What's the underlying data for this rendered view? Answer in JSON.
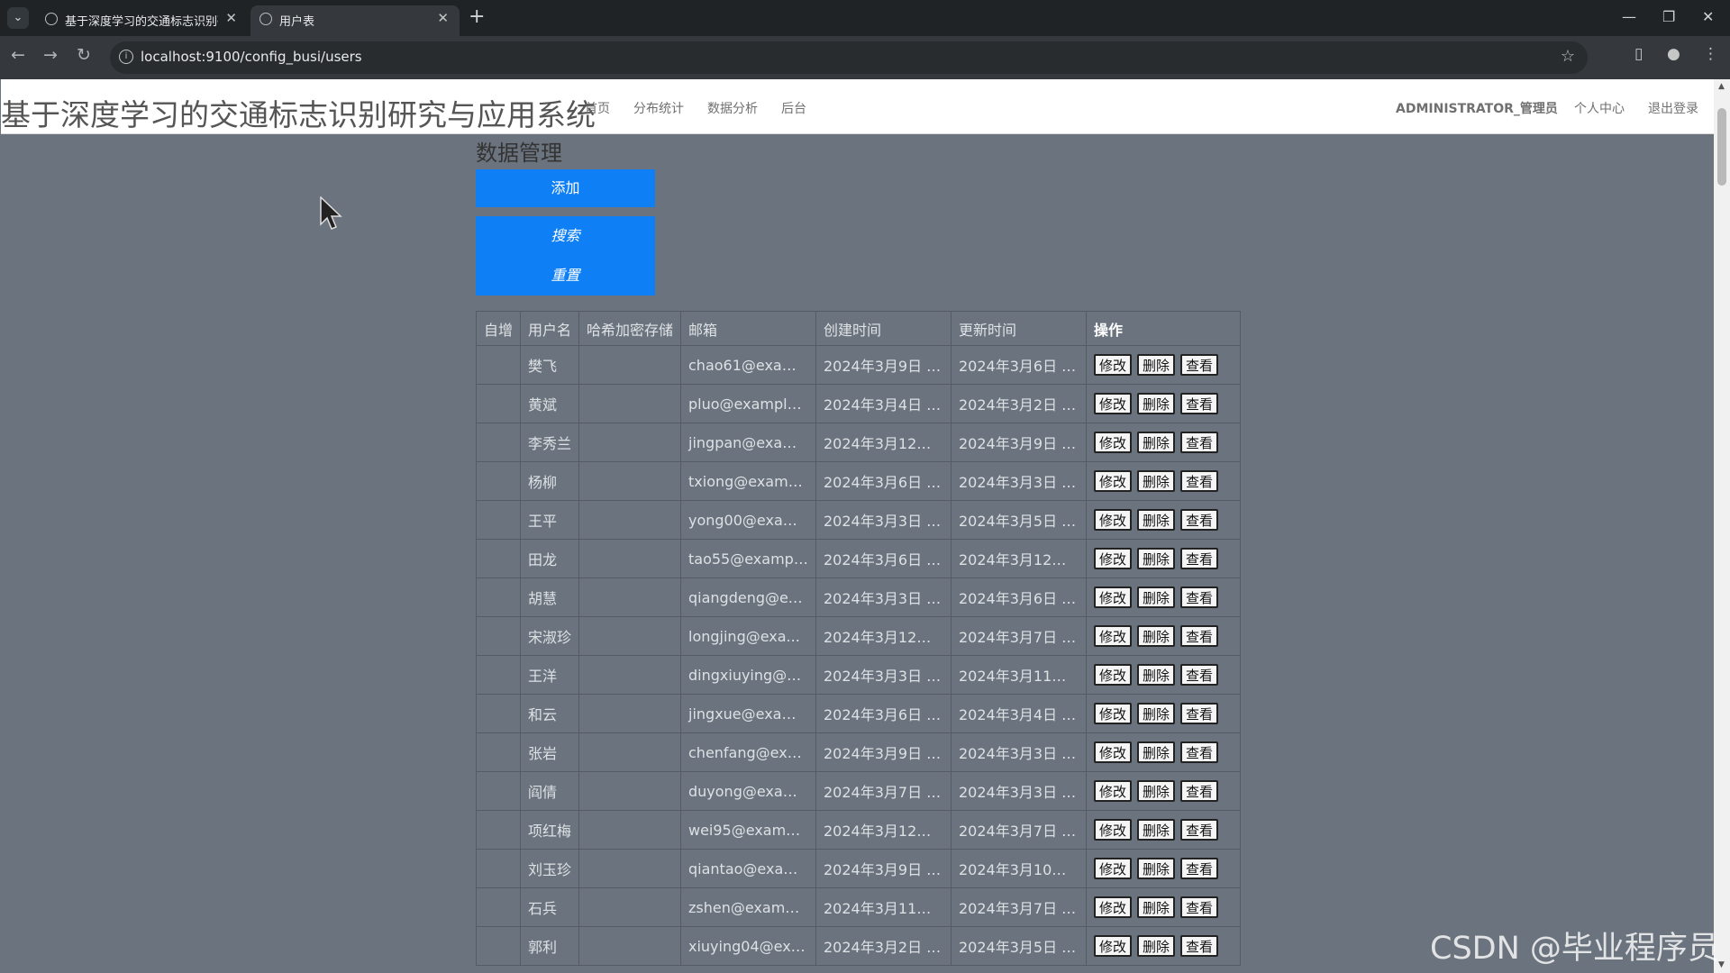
{
  "browser": {
    "tabs": [
      {
        "title": "基于深度学习的交通标志识别研",
        "active": false
      },
      {
        "title": "用户表",
        "active": true
      }
    ],
    "url": "localhost:9100/config_busi/users"
  },
  "header": {
    "brand": "基于深度学习的交通标志识别研究与应用系统",
    "nav": [
      "首页",
      "分布统计",
      "数据分析",
      "后台"
    ],
    "user": "ADMINISTRATOR_管理员",
    "center": "个人中心",
    "logout": "退出登录"
  },
  "main": {
    "title": "数据管理",
    "add_label": "添加",
    "search_label": "搜索",
    "reset_label": "重置"
  },
  "table": {
    "columns": [
      "自增",
      "用户名",
      "哈希加密存储",
      "邮箱",
      "创建时间",
      "更新时间",
      "操作"
    ],
    "actions": [
      "修改",
      "删除",
      "查看"
    ],
    "rows": [
      {
        "id": "",
        "username": "樊飞",
        "hash": "",
        "email": "chao61@exam...",
        "created": "2024年3月9日 0...",
        "updated": "2024年3月6日 0..."
      },
      {
        "id": "",
        "username": "黄斌",
        "hash": "",
        "email": "pluo@example....",
        "created": "2024年3月4日 0...",
        "updated": "2024年3月2日 0..."
      },
      {
        "id": "",
        "username": "李秀兰",
        "hash": "",
        "email": "jingpan@exam...",
        "created": "2024年3月12日 ...",
        "updated": "2024年3月9日 0..."
      },
      {
        "id": "",
        "username": "杨柳",
        "hash": "",
        "email": "txiong@examp...",
        "created": "2024年3月6日 0...",
        "updated": "2024年3月3日 0..."
      },
      {
        "id": "",
        "username": "王平",
        "hash": "",
        "email": "yong00@exam...",
        "created": "2024年3月3日 0...",
        "updated": "2024年3月5日 0..."
      },
      {
        "id": "",
        "username": "田龙",
        "hash": "",
        "email": "tao55@exampl...",
        "created": "2024年3月6日 0...",
        "updated": "2024年3月12日 ..."
      },
      {
        "id": "",
        "username": "胡慧",
        "hash": "",
        "email": "qiangdeng@ex...",
        "created": "2024年3月3日 0...",
        "updated": "2024年3月6日 0..."
      },
      {
        "id": "",
        "username": "宋淑珍",
        "hash": "",
        "email": "longjing@exa...",
        "created": "2024年3月12日 ...",
        "updated": "2024年3月7日 0..."
      },
      {
        "id": "",
        "username": "王洋",
        "hash": "",
        "email": "dingxiuying@e...",
        "created": "2024年3月3日 0...",
        "updated": "2024年3月11日 ..."
      },
      {
        "id": "",
        "username": "和云",
        "hash": "",
        "email": "jingxue@exam...",
        "created": "2024年3月6日 0...",
        "updated": "2024年3月4日 0..."
      },
      {
        "id": "",
        "username": "张岩",
        "hash": "",
        "email": "chenfang@exa...",
        "created": "2024年3月9日 0...",
        "updated": "2024年3月3日 0..."
      },
      {
        "id": "",
        "username": "阎倩",
        "hash": "",
        "email": "duyong@exam...",
        "created": "2024年3月7日 0...",
        "updated": "2024年3月3日 0..."
      },
      {
        "id": "",
        "username": "项红梅",
        "hash": "",
        "email": "wei95@exampl...",
        "created": "2024年3月12日 ...",
        "updated": "2024年3月7日 0..."
      },
      {
        "id": "",
        "username": "刘玉珍",
        "hash": "",
        "email": "qiantao@exam...",
        "created": "2024年3月9日 0...",
        "updated": "2024年3月10日 ..."
      },
      {
        "id": "",
        "username": "石兵",
        "hash": "",
        "email": "zshen@exampl...",
        "created": "2024年3月11日 ...",
        "updated": "2024年3月7日 0..."
      },
      {
        "id": "",
        "username": "郭利",
        "hash": "",
        "email": "xiuying04@exa...",
        "created": "2024年3月2日 0...",
        "updated": "2024年3月5日 0..."
      }
    ]
  },
  "watermark": "CSDN @毕业程序员",
  "colors": {
    "accent": "#0f7ff5",
    "page_bg": "#6b737e"
  }
}
